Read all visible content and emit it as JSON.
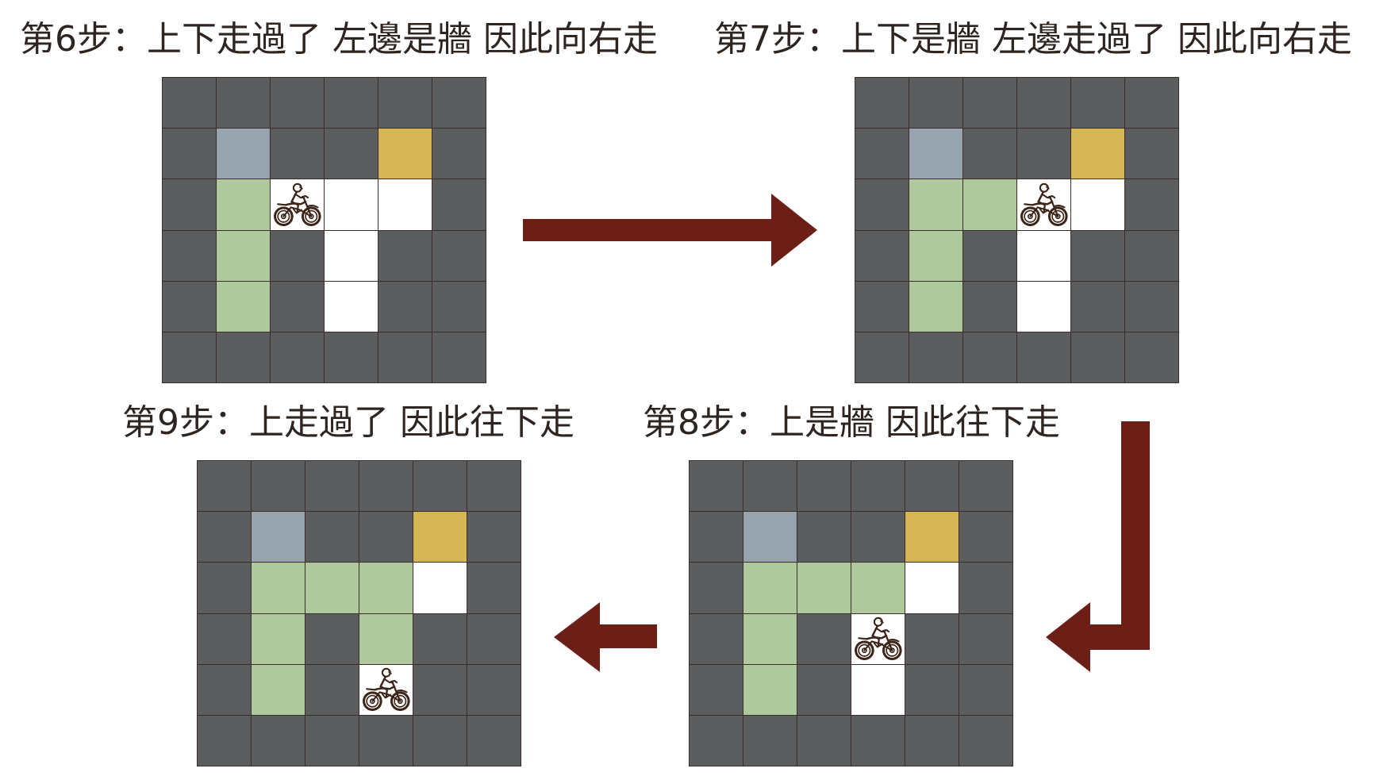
{
  "colors": {
    "background": "#ffffff",
    "title_text": "#2e2420",
    "grid_line": "#3a2d28",
    "arrow": "#6c1f17",
    "icon_stroke": "#3b2418"
  },
  "cell_colors": [
    "#5c5d5f",
    "#97a4b0",
    "#d4b654",
    "#b0c89e",
    "#ffffff",
    "#ffffff"
  ],
  "player_icon": "motorcycle-icon",
  "panels": [
    {
      "title": "第6步：上下走過了 左邊是牆 因此向右走",
      "grid": [
        [
          0,
          0,
          0,
          0,
          0,
          0
        ],
        [
          0,
          1,
          0,
          0,
          2,
          0
        ],
        [
          0,
          3,
          5,
          4,
          4,
          0
        ],
        [
          0,
          3,
          0,
          4,
          0,
          0
        ],
        [
          0,
          3,
          0,
          4,
          0,
          0
        ],
        [
          0,
          0,
          0,
          0,
          0,
          0
        ]
      ]
    },
    {
      "title": "第7步：上下是牆 左邊走過了 因此向右走",
      "grid": [
        [
          0,
          0,
          0,
          0,
          0,
          0
        ],
        [
          0,
          1,
          0,
          0,
          2,
          0
        ],
        [
          0,
          3,
          3,
          5,
          4,
          0
        ],
        [
          0,
          3,
          0,
          4,
          0,
          0
        ],
        [
          0,
          3,
          0,
          4,
          0,
          0
        ],
        [
          0,
          0,
          0,
          0,
          0,
          0
        ]
      ]
    },
    {
      "title": "第8步：上是牆 因此往下走",
      "grid": [
        [
          0,
          0,
          0,
          0,
          0,
          0
        ],
        [
          0,
          1,
          0,
          0,
          2,
          0
        ],
        [
          0,
          3,
          3,
          3,
          4,
          0
        ],
        [
          0,
          3,
          0,
          5,
          0,
          0
        ],
        [
          0,
          3,
          0,
          4,
          0,
          0
        ],
        [
          0,
          0,
          0,
          0,
          0,
          0
        ]
      ]
    },
    {
      "title": "第9步：上走過了 因此往下走",
      "grid": [
        [
          0,
          0,
          0,
          0,
          0,
          0
        ],
        [
          0,
          1,
          0,
          0,
          2,
          0
        ],
        [
          0,
          3,
          3,
          3,
          4,
          0
        ],
        [
          0,
          3,
          0,
          3,
          0,
          0
        ],
        [
          0,
          3,
          0,
          5,
          0,
          0
        ],
        [
          0,
          0,
          0,
          0,
          0,
          0
        ]
      ]
    }
  ]
}
